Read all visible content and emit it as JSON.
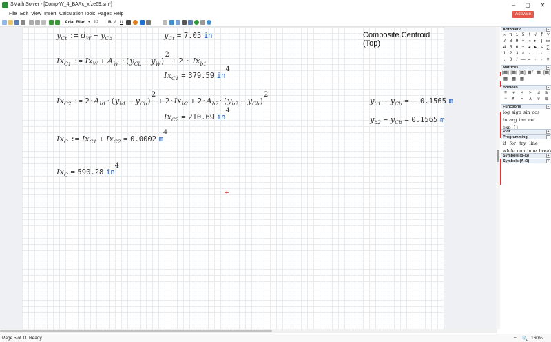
{
  "window": {
    "title": "SMath Solver - [Comp-W_4_BARc_xfze69.sm*]",
    "controls": [
      "–",
      "▢",
      "✕"
    ]
  },
  "menu": [
    "File",
    "Edit",
    "View",
    "Insert",
    "Calculation",
    "Tools",
    "Pages",
    "Help"
  ],
  "activate_label": "Activate",
  "toolbar": {
    "font": "Arial Blac",
    "size": "12",
    "bold": "B",
    "italic": "I",
    "underline": "U"
  },
  "sheet": {
    "heading": "Composite Centroid (Top)",
    "yct_def": {
      "lhs": "y",
      "lhs_sub": "Ct",
      "op": ":=",
      "d": "d",
      "d_sub": "W",
      "minus": "−",
      "y": "y",
      "y_sub": "Cb"
    },
    "yct_result": {
      "var": "y",
      "sub": "Ct",
      "eq": "=",
      "value": "7.05",
      "unit": "in"
    },
    "ixc1_def": {
      "lhs": "Ix",
      "lhs_sub": "C1",
      "op": ":=",
      "t1": "Ix",
      "t1_sub": "W",
      "plus": "+",
      "A": "A",
      "A_sub": "W",
      "dot": "·",
      "y1": "y",
      "y1_sub": "Cb",
      "minus": "−",
      "y2": "y",
      "y2_sub": "W",
      "pow": "2",
      "plus2": "+",
      "two": "2",
      "dot2": "·",
      "t3": "Ix",
      "t3_sub": "b1"
    },
    "ixc1_result": {
      "var": "Ix",
      "sub": "C1",
      "eq": "=",
      "value": "379.59",
      "unit": "in",
      "pow": "4"
    },
    "ixc2_def": {
      "lhs": "Ix",
      "lhs_sub": "C2",
      "op": ":=",
      "two": "2",
      "A": "A",
      "A_sub": "b1",
      "y1": "y",
      "y1_sub": "b1",
      "y2": "y",
      "y2_sub": "Cb",
      "pow": "2",
      "ix": "Ix",
      "ix_sub": "b2",
      "A2": "A",
      "A2_sub": "b2",
      "y3": "y",
      "y3_sub": "b2",
      "y4": "y",
      "y4_sub": "Cb"
    },
    "ixc2_result": {
      "var": "Ix",
      "sub": "C2",
      "eq": "=",
      "value": "210.69",
      "unit": "in",
      "pow": "4"
    },
    "diff1": {
      "y": "y",
      "y_sub": "b1",
      "minus": "−",
      "y2": "y",
      "y2_sub": "Cb",
      "eq": "=",
      "value": "− 0.1565",
      "unit": "m"
    },
    "diff2": {
      "y": "y",
      "y_sub": "b2",
      "minus": "−",
      "y2": "y",
      "y2_sub": "Cb",
      "eq": "=",
      "value": "0.1565",
      "unit": "m"
    },
    "ixc_def": {
      "lhs": "Ix",
      "lhs_sub": "C",
      "op": ":=",
      "t1": "Ix",
      "t1_sub": "C1",
      "plus": "+",
      "t2": "Ix",
      "t2_sub": "C2",
      "eq": "=",
      "value": "0.0002",
      "unit": "m",
      "pow": "4"
    },
    "ixc_result": {
      "var": "Ix",
      "sub": "C",
      "eq": "=",
      "value": "590.28",
      "unit": "in",
      "pow": "4"
    },
    "cursor": "+"
  },
  "panels": {
    "arithmetic": {
      "title": "Arithmetic",
      "keys": [
        "∞",
        "π",
        "1",
        "5",
        "!",
        "√",
        "∛",
        "⁺⁄",
        "7",
        "8",
        "9",
        "+",
        "◂",
        "▸",
        "∫",
        "▭",
        "4",
        "5",
        "6",
        "−",
        "◂",
        "▸",
        "≤",
        "∑",
        "1",
        "2",
        "3",
        "×",
        "·",
        "□",
        "·",
        "·",
        ",",
        "0",
        "/",
        "—",
        "=",
        "·",
        "·",
        "≡"
      ]
    },
    "matrices": {
      "title": "Matrices",
      "keys": [
        "[▦]",
        "|▦|",
        "[▦]",
        "▦ᵀ",
        "▦",
        "[▦]",
        "▦",
        "▦",
        "▦"
      ]
    },
    "boolean": {
      "title": "Boolean",
      "keys": [
        "≡",
        "≠",
        "<",
        ">",
        "≤",
        "≥",
        "≈",
        "≢",
        "¬",
        "∧",
        "∨",
        "⊕"
      ]
    },
    "functions": {
      "title": "Functions",
      "keys": [
        "log",
        "sign",
        "sin",
        "cos",
        "ln",
        "arg",
        "tan",
        "cot",
        "exp",
        "{}"
      ]
    },
    "plot": {
      "title": "Plot"
    },
    "programming": {
      "title": "Programming",
      "keys": [
        "if",
        "for",
        "try",
        "line",
        "while",
        "continue",
        "break"
      ]
    },
    "symbols1": {
      "title": "Symbols (α-ω)"
    },
    "symbols2": {
      "title": "Symbols (A-Ω)"
    }
  },
  "status": {
    "page": "Page 5 of 11",
    "state": "Ready",
    "zoom": "160%"
  },
  "colors": {
    "unit": "#1a5fd0",
    "activate": "#e8564a",
    "cursor": "#e02020"
  }
}
